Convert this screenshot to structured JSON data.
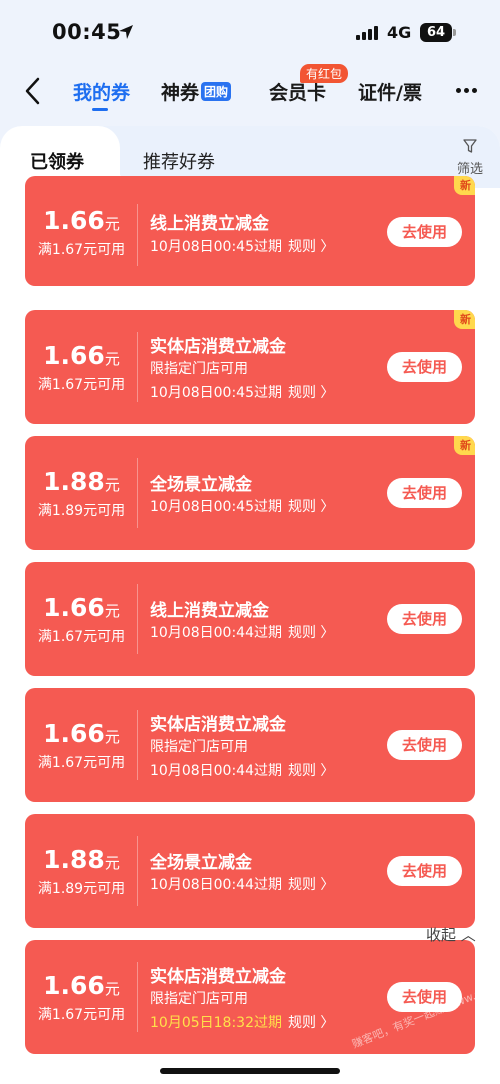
{
  "status_bar": {
    "time": "00:45",
    "network": "4G",
    "battery": "64"
  },
  "nav": {
    "tabs": [
      {
        "label": "我的券",
        "active": true
      },
      {
        "label": "神券",
        "pill": "团购"
      },
      {
        "label": "会员卡",
        "badge": "有红包"
      },
      {
        "label": "证件/票"
      }
    ]
  },
  "sub_tabs": {
    "active": "已领券",
    "inactive": "推荐好券",
    "filter": "筛选"
  },
  "coupons": [
    {
      "amount": "1.66",
      "unit": "元",
      "condition": "满1.67元可用",
      "title": "线上消费立减金",
      "subtitle": "",
      "expiry": "10月08日00:45过期",
      "rule": "规则 〉",
      "button": "去使用",
      "new": "新"
    },
    {
      "amount": "1.66",
      "unit": "元",
      "condition": "满1.67元可用",
      "title": "实体店消费立减金",
      "subtitle": "限指定门店可用",
      "expiry": "10月08日00:45过期",
      "rule": "规则 〉",
      "button": "去使用",
      "new": "新"
    },
    {
      "amount": "1.88",
      "unit": "元",
      "condition": "满1.89元可用",
      "title": "全场景立减金",
      "subtitle": "",
      "expiry": "10月08日00:45过期",
      "rule": "规则 〉",
      "button": "去使用",
      "new": "新"
    },
    {
      "amount": "1.66",
      "unit": "元",
      "condition": "满1.67元可用",
      "title": "线上消费立减金",
      "subtitle": "",
      "expiry": "10月08日00:44过期",
      "rule": "规则 〉",
      "button": "去使用",
      "new": ""
    },
    {
      "amount": "1.66",
      "unit": "元",
      "condition": "满1.67元可用",
      "title": "实体店消费立减金",
      "subtitle": "限指定门店可用",
      "expiry": "10月08日00:44过期",
      "rule": "规则 〉",
      "button": "去使用",
      "new": ""
    },
    {
      "amount": "1.88",
      "unit": "元",
      "condition": "满1.89元可用",
      "title": "全场景立减金",
      "subtitle": "",
      "expiry": "10月08日00:44过期",
      "rule": "规则 〉",
      "button": "去使用",
      "new": ""
    },
    {
      "amount": "1.66",
      "unit": "元",
      "condition": "满1.67元可用",
      "title": "实体店消费立减金",
      "subtitle": "限指定门店可用",
      "expiry": "10月05日18:32过期",
      "expiry_warn": true,
      "rule": "规则 〉",
      "button": "去使用",
      "new": ""
    }
  ],
  "collapse_label": "收起 ︿",
  "watermark": "赚客吧，有奖一起赚 www.zuanke8.com",
  "colors": {
    "accent": "#1e6ef0",
    "coupon_bg": "#f55a52",
    "warn": "#ffe14a"
  }
}
